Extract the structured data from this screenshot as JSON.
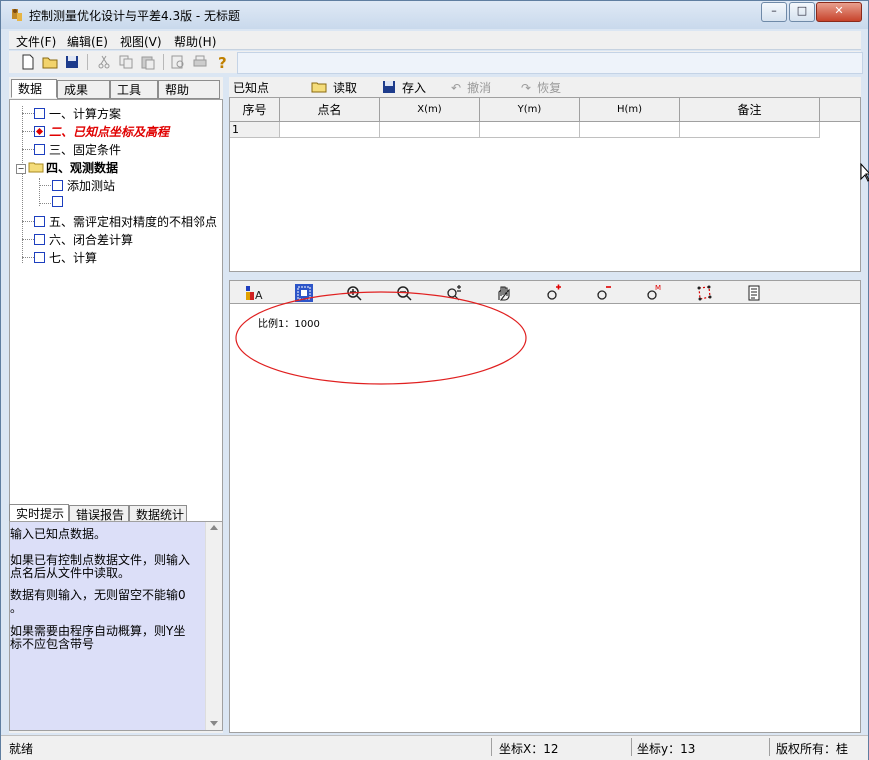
{
  "window": {
    "title": "控制测量优化设计与平差4.3版 - 无标题",
    "btn_min": "–",
    "btn_max": "□",
    "btn_close": "✕"
  },
  "menu": [
    {
      "label": "文件(F)"
    },
    {
      "label": "编辑(E)"
    },
    {
      "label": "视图(V)"
    },
    {
      "label": "帮助(H)"
    }
  ],
  "left_tabs": [
    {
      "label": "数据",
      "active": true
    },
    {
      "label": "成果",
      "active": false
    },
    {
      "label": "工具",
      "active": false
    },
    {
      "label": "帮助",
      "active": false
    }
  ],
  "tree": [
    {
      "label": "一、计算方案",
      "style": "normal"
    },
    {
      "label": "二、已知点坐标及高程",
      "style": "selected"
    },
    {
      "label": "三、固定条件",
      "style": "normal"
    },
    {
      "label": "四、观测数据",
      "style": "folder"
    },
    {
      "label": "添加测站",
      "style": "child"
    },
    {
      "label": "",
      "style": "child"
    },
    {
      "label": "五、需评定相对精度的不相邻点",
      "style": "normal"
    },
    {
      "label": "六、闭合差计算",
      "style": "normal"
    },
    {
      "label": "七、计算",
      "style": "normal"
    }
  ],
  "hint_tabs": [
    {
      "label": "实时提示",
      "active": true
    },
    {
      "label": "错误报告",
      "active": false
    },
    {
      "label": "数据统计",
      "active": false
    }
  ],
  "hint_lines": [
    "输入已知点数据。",
    "",
    "    如果已有控制点数据文件，则输入",
    "点名后从文件中读取。",
    "",
    "    数据有则输入，无则留空不能输0",
    "。",
    "",
    "    如果需要由程序自动概算，则Y坐",
    "标不应包含带号"
  ],
  "known_points": {
    "title": "已知点",
    "read_label": "读取",
    "save_label": "存入",
    "undo_label": "撤消",
    "redo_label": "恢复",
    "columns": [
      "序号",
      "点名",
      "X(m)",
      "Y(m)",
      "H(m)",
      "备注"
    ],
    "rows": [
      [
        "1",
        "",
        "",
        "",
        "",
        ""
      ]
    ]
  },
  "canvas": {
    "scale_text": "比例1：1000"
  },
  "status": {
    "ready": "就绪",
    "coord_x": "坐标X：12",
    "coord_y": "坐标y：13",
    "copyright": "版权所有：桂"
  },
  "colors": {
    "selected_text": "#e00000",
    "annotation": "#e02020",
    "tree_checkbox": "#1d3fbf"
  }
}
